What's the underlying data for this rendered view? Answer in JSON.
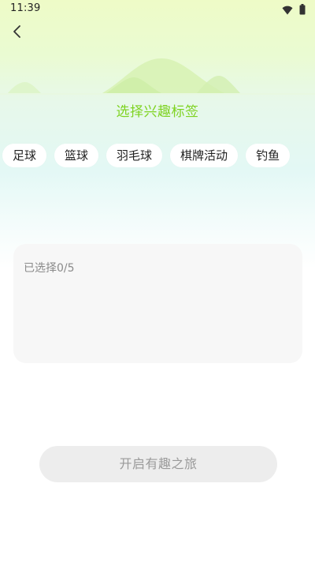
{
  "status_bar": {
    "time": "11:39",
    "icons": [
      "wifi-icon",
      "battery-icon"
    ]
  },
  "header": {
    "back_icon": "chevron-left-icon",
    "title": "选择兴趣标签"
  },
  "tags": [
    {
      "label": "足球"
    },
    {
      "label": "篮球"
    },
    {
      "label": "羽毛球"
    },
    {
      "label": "棋牌活动"
    },
    {
      "label": "钓鱼"
    }
  ],
  "selected_panel": {
    "count_text": "已选择0/5"
  },
  "actions": {
    "start_label": "开启有趣之旅"
  },
  "colors": {
    "accent": "#7ed321",
    "button_bg": "#ededed",
    "panel_bg": "#f7f7f7"
  }
}
